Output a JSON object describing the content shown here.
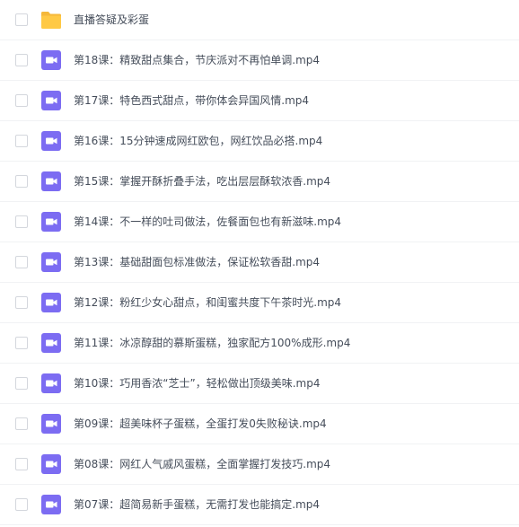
{
  "file_list": {
    "items": [
      {
        "name": "直播答疑及彩蛋",
        "type": "folder",
        "icon": "folder-icon"
      },
      {
        "name": "第18课：精致甜点集合，节庆派对不再怕单调.mp4",
        "type": "video",
        "icon": "video-file-icon"
      },
      {
        "name": "第17课：特色西式甜点，带你体会异国风情.mp4",
        "type": "video",
        "icon": "video-file-icon"
      },
      {
        "name": "第16课：15分钟速成网红欧包，网红饮品必搭.mp4",
        "type": "video",
        "icon": "video-file-icon"
      },
      {
        "name": "第15课：掌握开酥折叠手法，吃出层层酥软浓香.mp4",
        "type": "video",
        "icon": "video-file-icon"
      },
      {
        "name": "第14课：不一样的吐司做法，佐餐面包也有新滋味.mp4",
        "type": "video",
        "icon": "video-file-icon"
      },
      {
        "name": "第13课：基础甜面包标准做法，保证松软香甜.mp4",
        "type": "video",
        "icon": "video-file-icon"
      },
      {
        "name": "第12课：粉红少女心甜点，和闺蜜共度下午茶时光.mp4",
        "type": "video",
        "icon": "video-file-icon"
      },
      {
        "name": "第11课：冰凉醇甜的慕斯蛋糕，独家配方100%成形.mp4",
        "type": "video",
        "icon": "video-file-icon"
      },
      {
        "name": "第10课：巧用香浓“芝士”，轻松做出顶级美味.mp4",
        "type": "video",
        "icon": "video-file-icon"
      },
      {
        "name": "第09课：超美味杯子蛋糕，全蛋打发0失败秘诀.mp4",
        "type": "video",
        "icon": "video-file-icon"
      },
      {
        "name": "第08课：网红人气戚风蛋糕，全面掌握打发技巧.mp4",
        "type": "video",
        "icon": "video-file-icon"
      },
      {
        "name": "第07课：超简易新手蛋糕，无需打发也能搞定.mp4",
        "type": "video",
        "icon": "video-file-icon"
      }
    ]
  },
  "colors": {
    "folder": "#ffc945",
    "folder_tab": "#f5b83a",
    "video_icon": "#7c6cf2",
    "text": "#454d5a",
    "checkbox_border": "#d4d7dd",
    "row_divider": "#f1f2f4"
  }
}
